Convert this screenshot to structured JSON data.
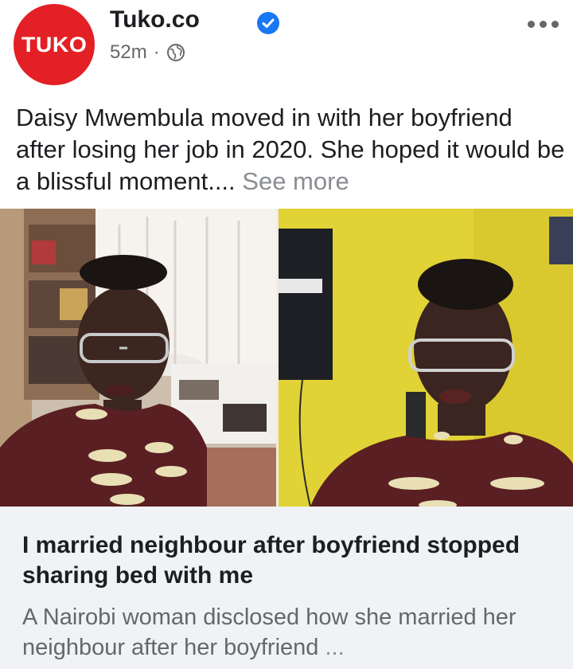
{
  "post": {
    "avatar_text": "TUKO",
    "page_name": "Tuko.co",
    "time": "52m",
    "separator": "·",
    "caption": "Daisy Mwembula moved in with her boyfriend after losing her job in 2020. She hoped it would be a blissful moment....",
    "see_more": "See more"
  },
  "link_preview": {
    "headline": "I married neighbour after boyfriend stopped sharing bed with me",
    "description": "A Nairobi woman disclosed how she married her neighbour after her boyfriend",
    "ellipsis": "..."
  },
  "icons": {
    "verified": "verified-badge-icon",
    "globe": "globe-icon",
    "more": "more-options-icon"
  },
  "colors": {
    "brand_red": "#e32026",
    "verified_blue": "#1877f2",
    "secondary_text": "#65676b",
    "preview_bg": "#f0f2f5"
  }
}
